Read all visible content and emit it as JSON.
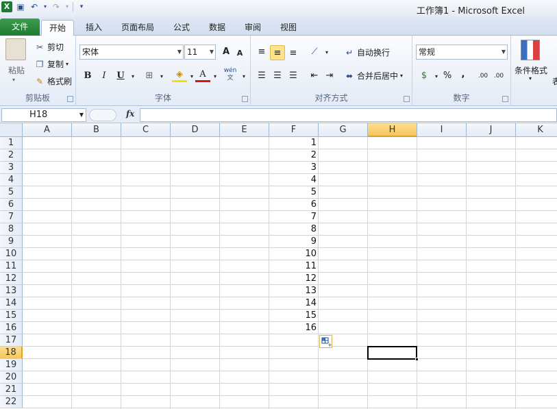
{
  "window": {
    "title": "工作簿1 - Microsoft Excel"
  },
  "qat": {
    "logo": "X",
    "save_icon": "save-icon",
    "undo_icon": "undo-icon",
    "redo_icon": "redo-icon"
  },
  "tabs": [
    {
      "label": "文件"
    },
    {
      "label": "开始"
    },
    {
      "label": "插入"
    },
    {
      "label": "页面布局"
    },
    {
      "label": "公式"
    },
    {
      "label": "数据"
    },
    {
      "label": "审阅"
    },
    {
      "label": "视图"
    }
  ],
  "ribbon": {
    "clipboard": {
      "paste": "粘贴",
      "cut": "剪切",
      "copy": "复制",
      "format_painter": "格式刷",
      "label": "剪贴板"
    },
    "font": {
      "name": "宋体",
      "size": "11",
      "bold": "B",
      "italic": "I",
      "underline": "U",
      "grow": "A",
      "shrink": "A",
      "font_color": "A",
      "phonetic": "wén 文",
      "label": "字体"
    },
    "alignment": {
      "wrap": "自动换行",
      "merge": "合并后居中",
      "label": "对齐方式"
    },
    "number": {
      "format": "常规",
      "percent": "%",
      "comma": ",",
      "inc_decimal": ".00",
      "dec_decimal": ".00",
      "label": "数字"
    },
    "styles": {
      "conditional": "条件格式",
      "partial": "表"
    }
  },
  "formula_bar": {
    "name_box": "H18",
    "fx": "fx",
    "content": ""
  },
  "columns": [
    "A",
    "B",
    "C",
    "D",
    "E",
    "F",
    "G",
    "H",
    "I",
    "J",
    "K"
  ],
  "rows": [
    "1",
    "2",
    "3",
    "4",
    "5",
    "6",
    "7",
    "8",
    "9",
    "10",
    "11",
    "12",
    "13",
    "14",
    "15",
    "16",
    "17",
    "18",
    "19",
    "20",
    "21",
    "22"
  ],
  "active_cell": {
    "column": "H",
    "row": "18"
  },
  "cells_F": [
    "1",
    "2",
    "3",
    "4",
    "5",
    "6",
    "7",
    "8",
    "9",
    "10",
    "11",
    "12",
    "13",
    "14",
    "15",
    "16"
  ],
  "autofill_icon": "auto-fill-options-icon"
}
